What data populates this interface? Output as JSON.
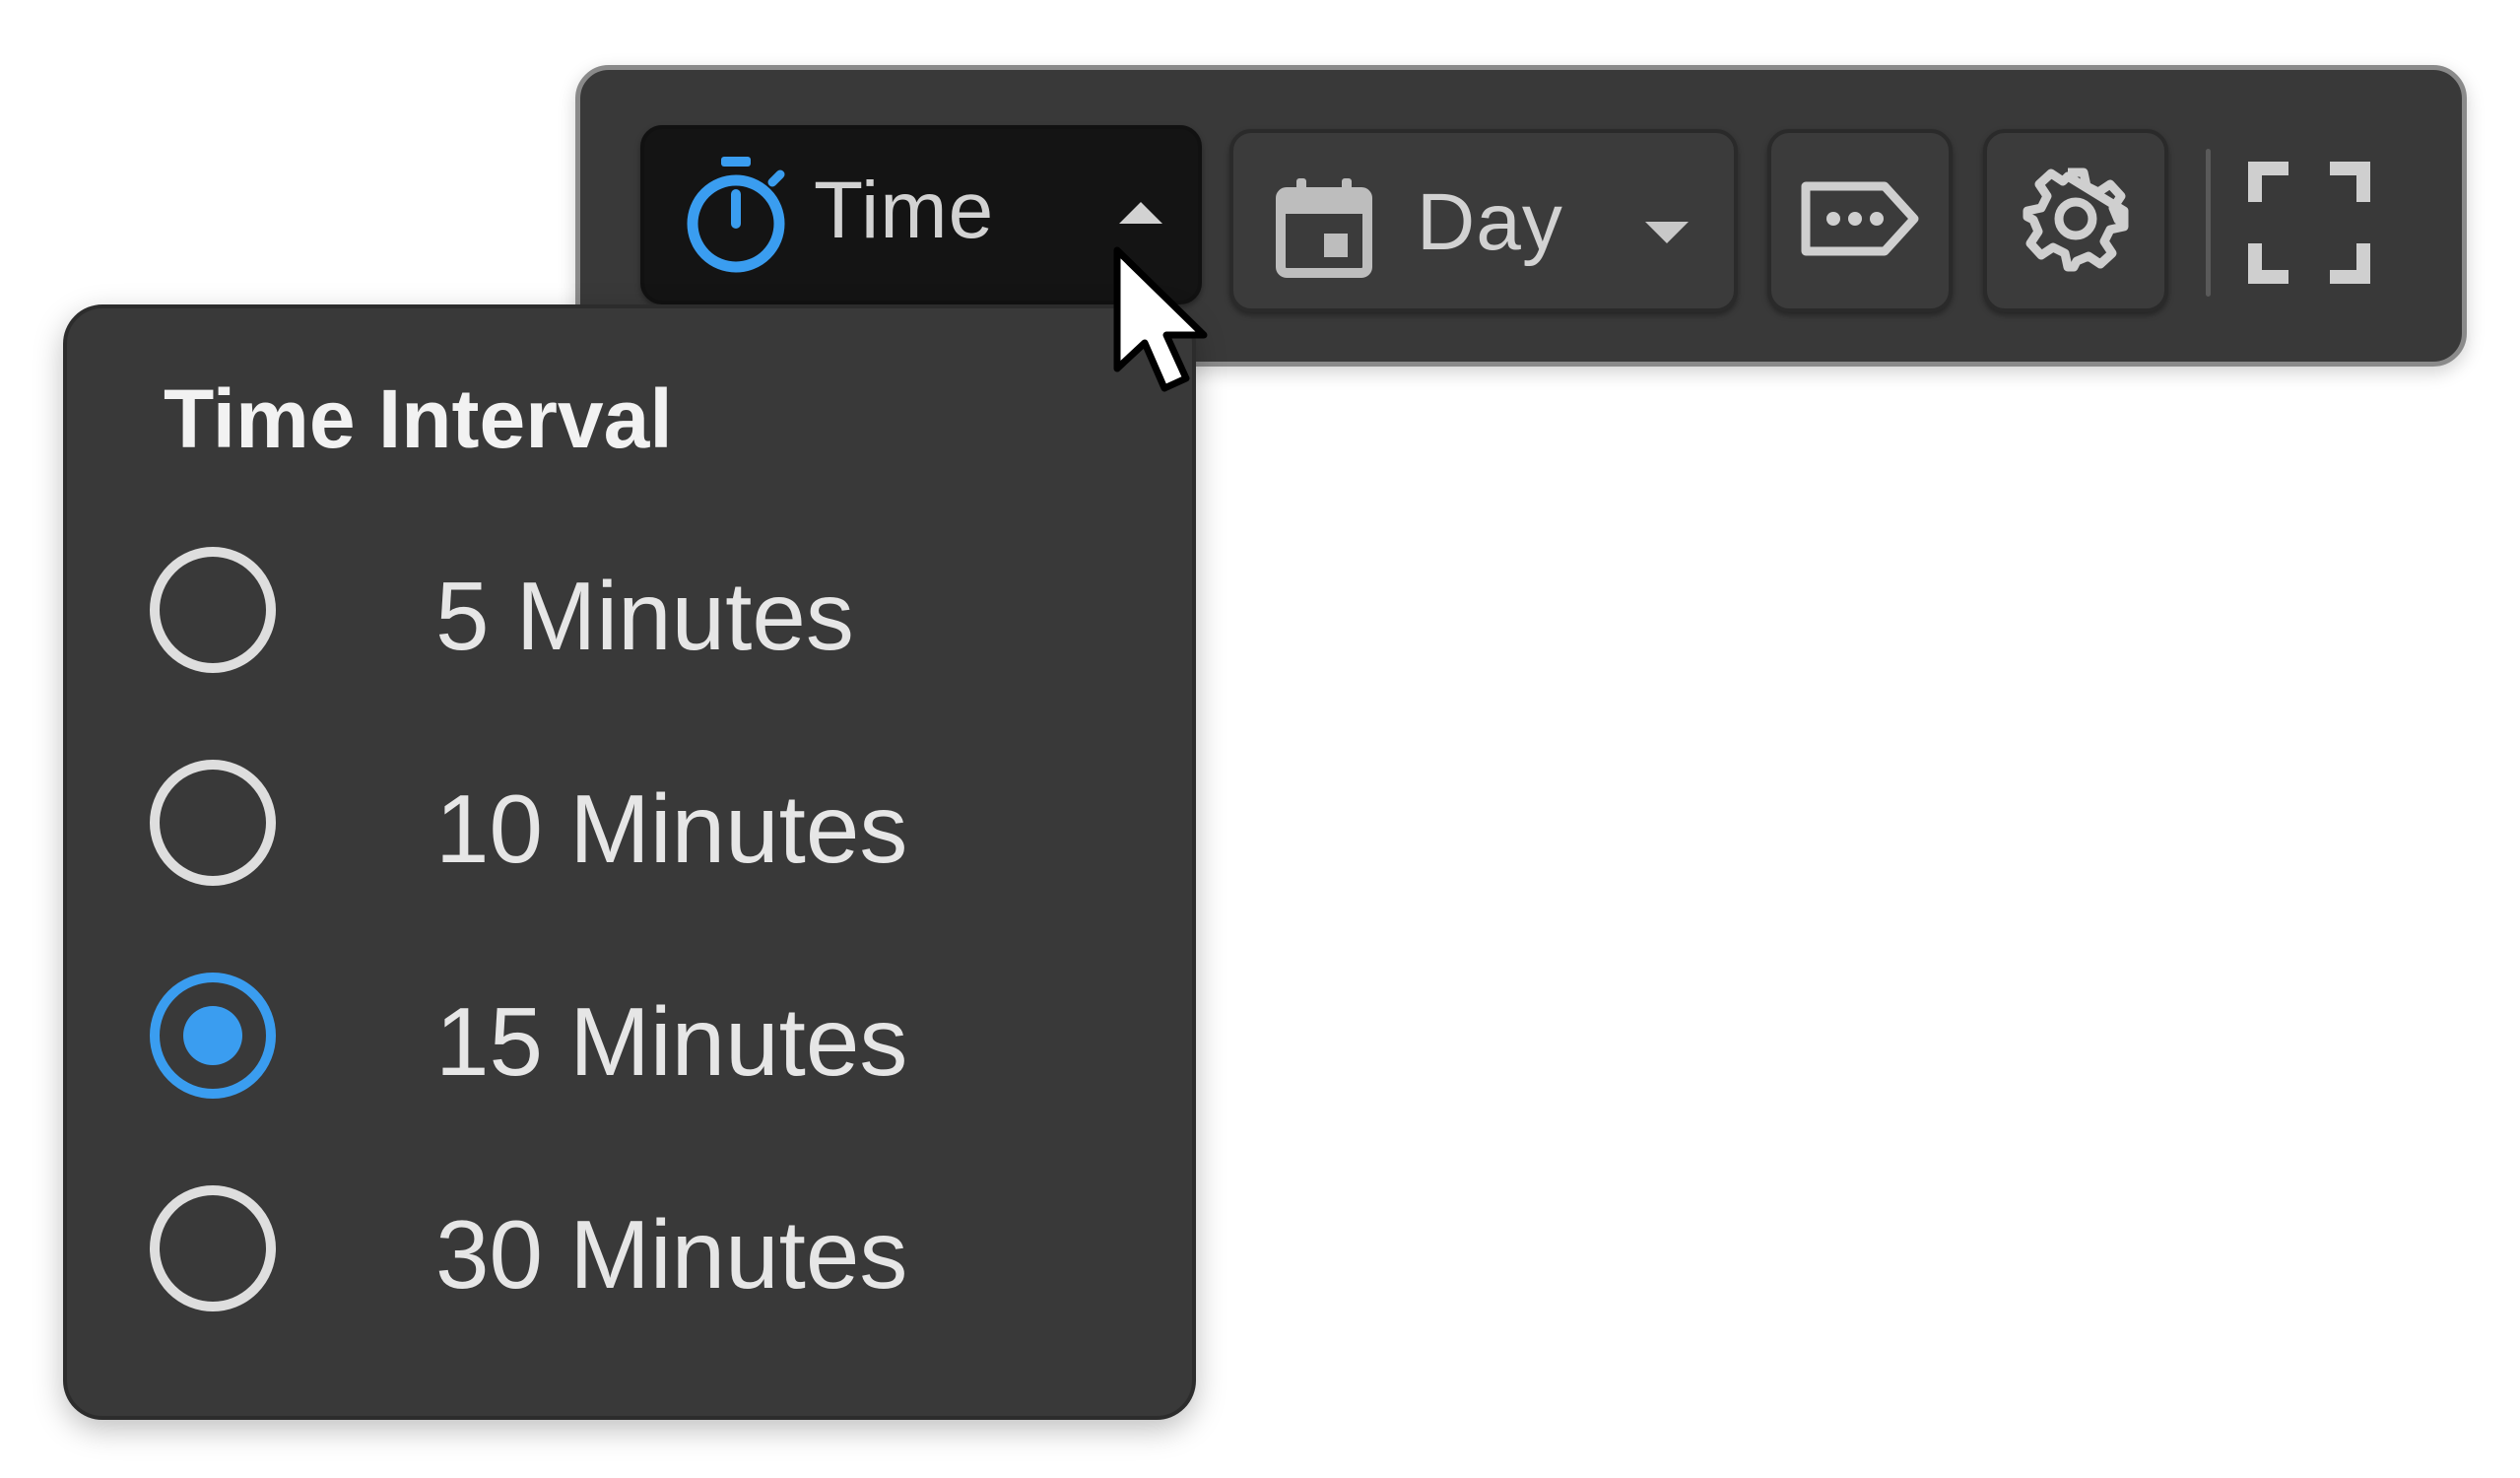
{
  "toolbar": {
    "time_button": {
      "label": "Time",
      "icon": "stopwatch-icon",
      "state": "open",
      "caret": "caret-up-icon",
      "icon_color": "#3a9df0"
    },
    "day_button": {
      "label": "Day",
      "icon": "calendar-icon",
      "caret": "caret-down-icon"
    },
    "tag_button": {
      "icon": "tag-more-icon"
    },
    "settings_button": {
      "icon": "gear-icon"
    },
    "fullscreen_button": {
      "icon": "fullscreen-icon"
    }
  },
  "dropdown": {
    "title": "Time Interval",
    "options": [
      {
        "label": "5 Minutes",
        "selected": false
      },
      {
        "label": "10 Minutes",
        "selected": false
      },
      {
        "label": "15 Minutes",
        "selected": true
      },
      {
        "label": "30 Minutes",
        "selected": false
      }
    ],
    "accent_color": "#3a9df0"
  },
  "colors": {
    "panel_bg": "#393939",
    "toolbar_border": "#8a8a8a",
    "active_button_bg": "#141414",
    "text": "#e6e6e6"
  }
}
